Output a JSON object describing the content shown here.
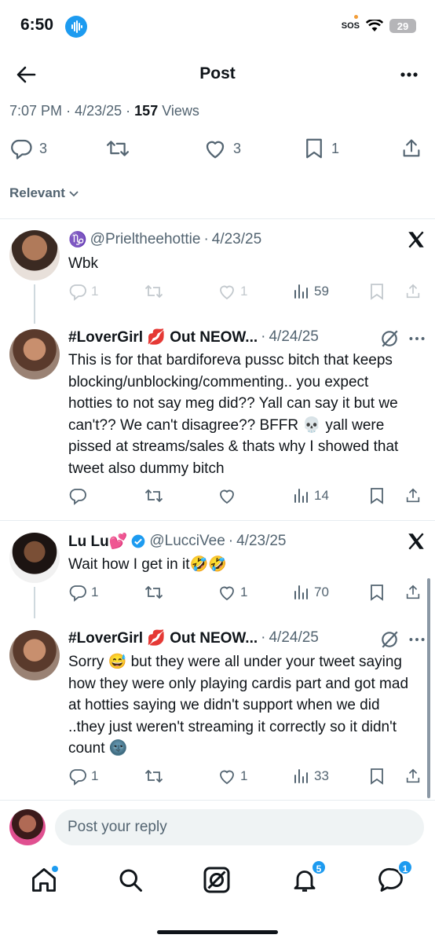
{
  "status": {
    "time": "6:50",
    "sos": "SOS",
    "battery": "29"
  },
  "header": {
    "title": "Post"
  },
  "post": {
    "time": "7:07 PM",
    "sep1": "·",
    "date": "4/23/25",
    "sep2": "·",
    "views_count": "157",
    "views_label": "Views",
    "replies": "3",
    "likes": "3",
    "bookmarks": "1"
  },
  "filter": {
    "label": "Relevant"
  },
  "tweets": [
    {
      "zodiac": "♑",
      "handle": "@Prieltheehottie",
      "sep": "·",
      "date": "4/23/25",
      "text": "Wbk",
      "replies": "1",
      "likes": "1",
      "views": "59"
    },
    {
      "name": "#LoverGirl 💋 Out NEOW...",
      "sep": "·",
      "date": "4/24/25",
      "text": "This is for that bardiforeva pussc bitch that keeps blocking/unblocking/commenting.. you expect hotties to not say meg did?? Yall can say it but we can't?? We can't disagree?? BFFR 💀 yall were pissed at streams/sales & thats why I showed that tweet also dummy bitch",
      "views": "14"
    },
    {
      "name": "Lu Lu💕",
      "handle": "@LucciVee",
      "sep": "·",
      "date": "4/23/25",
      "text": "Wait how I get in it🤣🤣",
      "replies": "1",
      "likes": "1",
      "views": "70"
    },
    {
      "name": "#LoverGirl 💋 Out NEOW...",
      "sep": "·",
      "date": "4/24/25",
      "text": "Sorry 😅 but they were all under your tweet saying how they were only playing cardis part and got mad at hotties saying we didn't support when we did ..they just weren't streaming it correctly so it didn't count 🌚",
      "replies": "1",
      "likes": "1",
      "views": "33"
    }
  ],
  "reply": {
    "placeholder": "Post your reply"
  },
  "tabs": {
    "notifications_badge": "5",
    "messages_badge": "1"
  },
  "colors": {
    "accent": "#1d9bf0",
    "text": "#0f1419",
    "muted": "#536471"
  },
  "icons": [
    "back-arrow-icon",
    "more-icon",
    "reply-icon",
    "retweet-icon",
    "heart-icon",
    "bookmark-icon",
    "share-icon",
    "x-logo-icon",
    "grok-icon",
    "views-icon",
    "verified-icon",
    "home-icon",
    "search-icon",
    "notifications-icon",
    "messages-icon"
  ]
}
